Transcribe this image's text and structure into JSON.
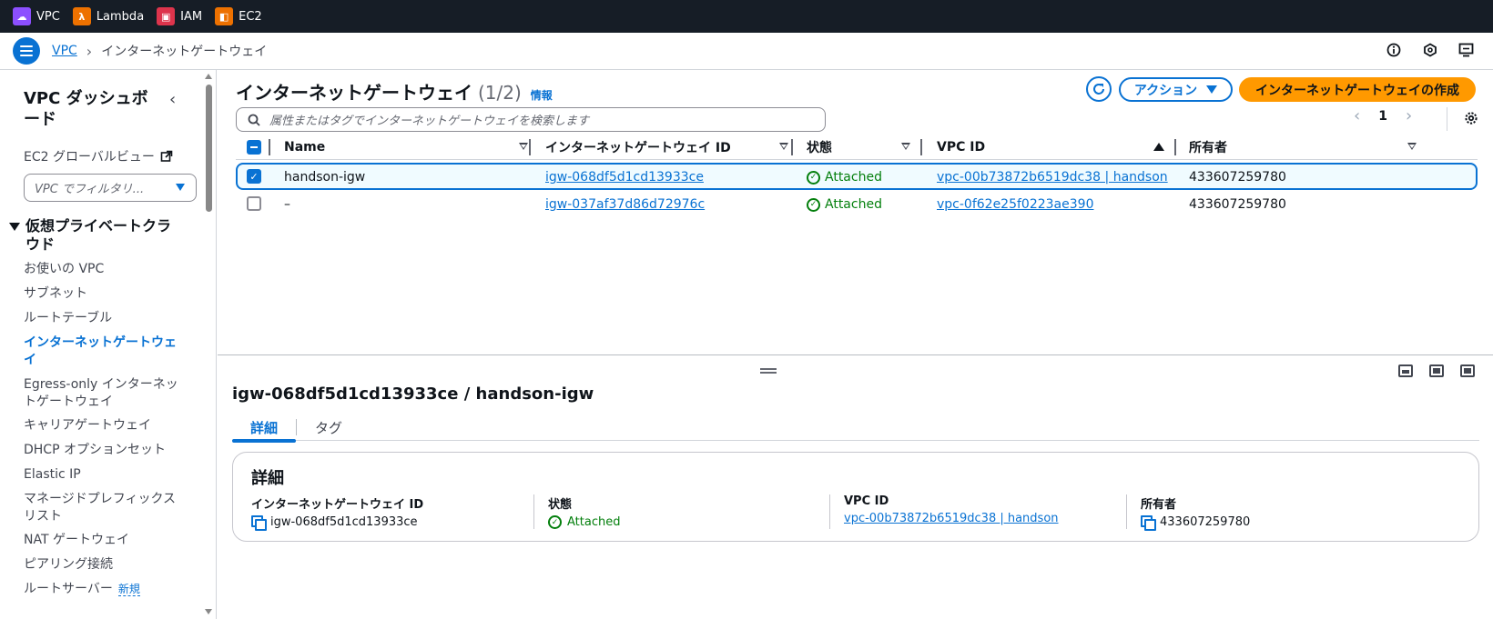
{
  "topbar": {
    "favorites": [
      {
        "label": "VPC",
        "color": "#8c4fff",
        "icon": "vpc-service-icon"
      },
      {
        "label": "Lambda",
        "color": "#ed7100",
        "icon": "lambda-service-icon"
      },
      {
        "label": "IAM",
        "color": "#dd344c",
        "icon": "iam-service-icon"
      },
      {
        "label": "EC2",
        "color": "#ed7100",
        "icon": "ec2-service-icon"
      }
    ]
  },
  "breadcrumb": {
    "root": "VPC",
    "current": "インターネットゲートウェイ"
  },
  "sidebar": {
    "title": "VPC ダッシュボード",
    "ec2_global": "EC2 グローバルビュー",
    "filter_placeholder": "VPC でフィルタリ...",
    "section": "仮想プライベートクラウド",
    "items": [
      "お使いの VPC",
      "サブネット",
      "ルートテーブル",
      "インターネットゲートウェイ",
      "Egress-only インターネットゲートウェイ",
      "キャリアゲートウェイ",
      "DHCP オプションセット",
      "Elastic IP",
      "マネージドプレフィックスリスト",
      "NAT ゲートウェイ",
      "ピアリング接続",
      "ルートサーバー"
    ],
    "new_badge": "新規"
  },
  "main": {
    "title": "インターネットゲートウェイ",
    "count": "(1/2)",
    "info": "情報",
    "actions_label": "アクション",
    "create_label": "インターネットゲートウェイの作成",
    "search_placeholder": "属性またはタグでインターネットゲートウェイを検索します",
    "page": "1",
    "columns": [
      "Name",
      "インターネットゲートウェイ ID",
      "状態",
      "VPC ID",
      "所有者"
    ],
    "rows": [
      {
        "name": "handson-igw",
        "id": "igw-068df5d1cd13933ce",
        "state": "Attached",
        "vpc": "vpc-00b73872b6519dc38 | handson",
        "owner": "433607259780",
        "selected": true
      },
      {
        "name": "–",
        "id": "igw-037af37d86d72976c",
        "state": "Attached",
        "vpc": "vpc-0f62e25f0223ae390",
        "owner": "433607259780",
        "selected": false
      }
    ]
  },
  "detail": {
    "title": "igw-068df5d1cd13933ce / handson-igw",
    "tabs": [
      "詳細",
      "タグ"
    ],
    "card_title": "詳細",
    "fields": {
      "id_label": "インターネットゲートウェイ ID",
      "id_value": "igw-068df5d1cd13933ce",
      "state_label": "状態",
      "state_value": "Attached",
      "vpc_label": "VPC ID",
      "vpc_value": "vpc-00b73872b6519dc38 | handson",
      "owner_label": "所有者",
      "owner_value": "433607259780"
    }
  }
}
